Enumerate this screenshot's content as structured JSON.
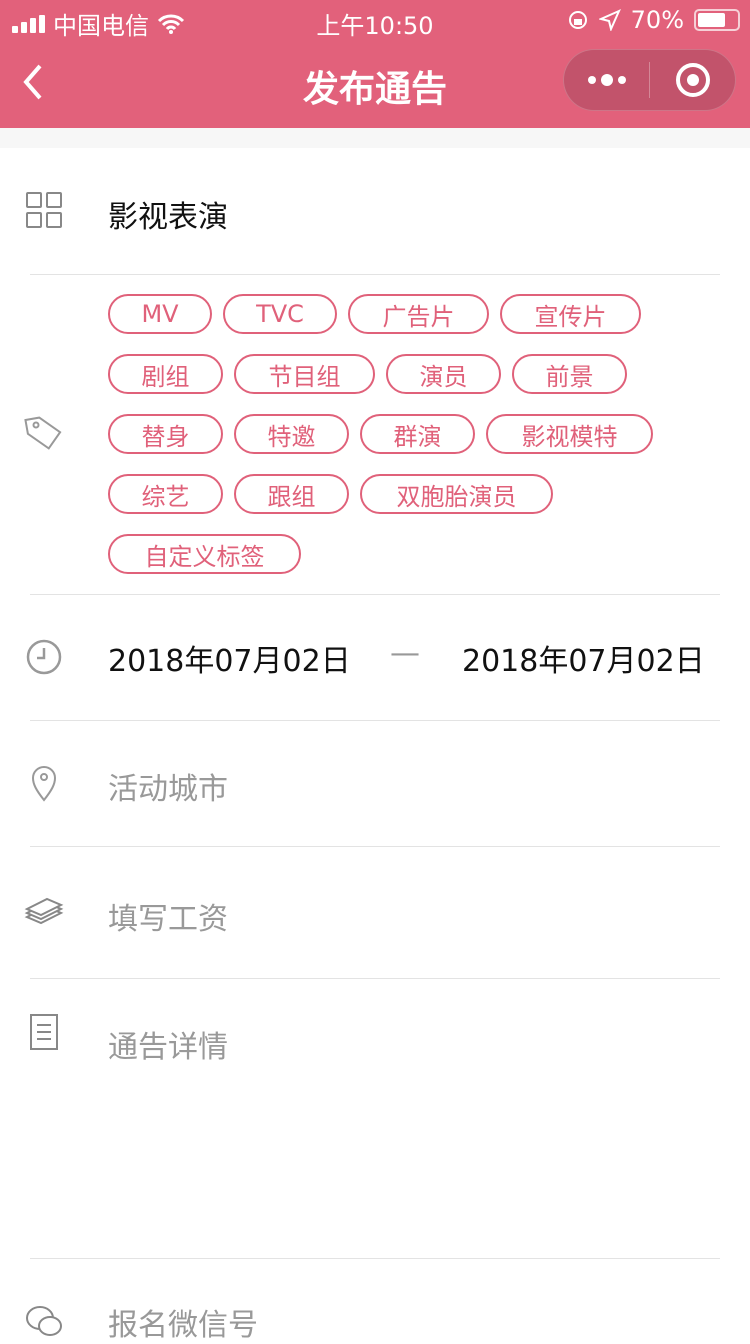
{
  "status": {
    "carrier": "中国电信",
    "time": "上午10:50",
    "battery": "70%",
    "battery_level": 0.7
  },
  "header": {
    "title": "发布通告"
  },
  "category": {
    "value": "影视表演"
  },
  "tags": {
    "rows": [
      [
        "MV",
        "TVC",
        "广告片",
        "宣传片"
      ],
      [
        "剧组",
        "节目组",
        "演员",
        "前景"
      ],
      [
        "替身",
        "特邀",
        "群演",
        "影视模特"
      ],
      [
        "综艺",
        "跟组",
        "双胞胎演员"
      ],
      [
        "自定义标签"
      ]
    ]
  },
  "date": {
    "start": "2018年07月02日",
    "separator": "—",
    "end": "2018年07月02日"
  },
  "city": {
    "placeholder": "活动城市"
  },
  "salary": {
    "placeholder": "填写工资"
  },
  "details": {
    "placeholder": "通告详情"
  },
  "wechat": {
    "placeholder": "报名微信号"
  },
  "colors": {
    "accent": "#e2617b"
  }
}
